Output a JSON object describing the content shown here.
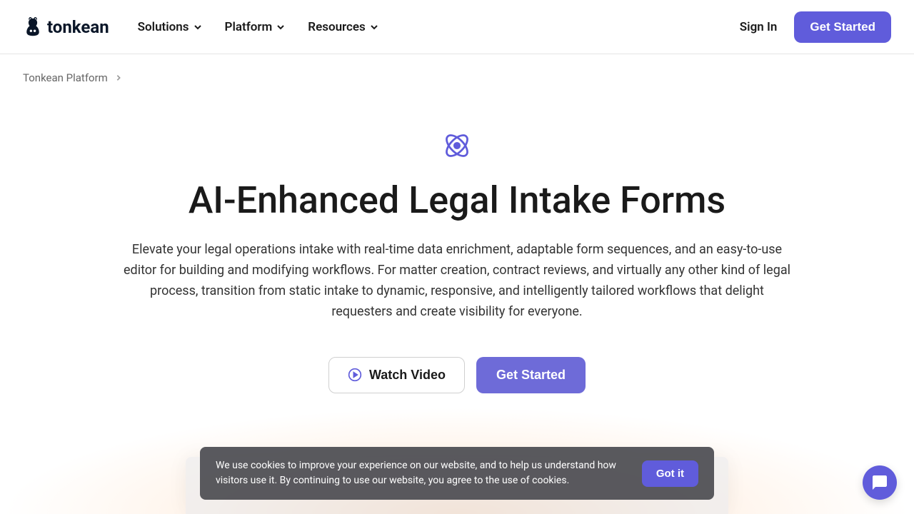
{
  "header": {
    "logo_text": "tonkean",
    "nav": [
      {
        "label": "Solutions"
      },
      {
        "label": "Platform"
      },
      {
        "label": "Resources"
      }
    ],
    "signin_label": "Sign In",
    "get_started_label": "Get Started"
  },
  "breadcrumb": {
    "item": "Tonkean Platform"
  },
  "hero": {
    "title": "AI-Enhanced Legal Intake Forms",
    "description": "Elevate your legal operations intake with real-time data enrichment, adaptable form sequences, and an easy-to-use editor for building and modifying workflows. For matter creation, contract reviews, and virtually any other kind of legal process, transition from static intake to dynamic, responsive, and intelligently tailored workflows that delight requesters and create visibility for everyone.",
    "watch_video_label": "Watch Video",
    "get_started_label": "Get Started"
  },
  "cookie_banner": {
    "text": "We use cookies to improve your experience on our website, and to help us understand how visitors use it. By continuing to use our website, you agree to the use of cookies.",
    "button_label": "Got it"
  },
  "colors": {
    "primary": "#605cdb"
  }
}
